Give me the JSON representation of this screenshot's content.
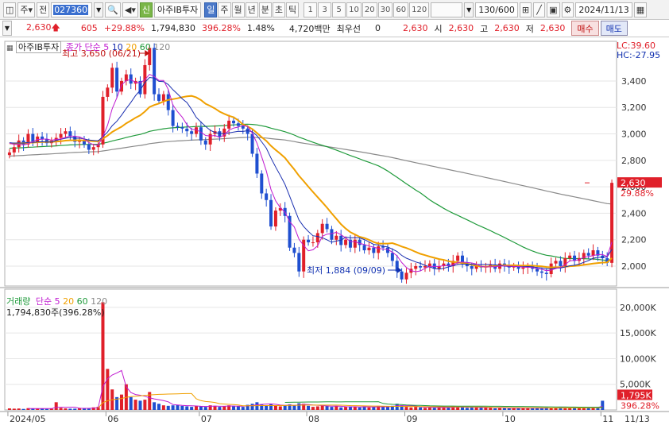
{
  "toolbar": {
    "market_label": "주",
    "type_label": "전",
    "code": "027360",
    "badge_new": "신",
    "stock_name": "아주IB투자",
    "periods": [
      "일",
      "주",
      "월",
      "년",
      "분",
      "초",
      "틱"
    ],
    "active_period": "일",
    "intervals": [
      "1",
      "3",
      "5",
      "10",
      "20",
      "30",
      "60",
      "120"
    ],
    "count": "130",
    "count_total": "/600",
    "date": "2024/11/13"
  },
  "info": {
    "price": "2,630",
    "change": "605",
    "change_pct": "+29.88%",
    "volume": "1,794,830",
    "volume_ratio": "396.28%",
    "turnover": "1.48%",
    "amount": "4,720백만",
    "preferred_label": "최우선",
    "preferred_value": "0",
    "current_price": "2,630",
    "open_label": "시",
    "open": "2,630",
    "high_label": "고",
    "high": "2,630",
    "low_label": "저",
    "low": "2,630",
    "buy_label": "매수",
    "sell_label": "매도"
  },
  "price_panel": {
    "title": "아주IB투자",
    "ma_label": "종가 단순",
    "ma_periods": [
      "5",
      "10",
      "20",
      "60",
      "120"
    ],
    "high_note": "최고 3,650 (06/21)",
    "low_note": "최저 1,884 (09/09)",
    "lc_label": "LC:39.60",
    "hc_label": "HC:-27.95",
    "current_price_tag": "2,630",
    "current_pct_tag": "29.88%",
    "y_ticks": [
      "3,400",
      "3,200",
      "3,000",
      "2,800",
      "2,600",
      "2,400",
      "2,200",
      "2,000"
    ]
  },
  "volume_panel": {
    "title": "거래량",
    "ma_label": "단순",
    "ma_periods": [
      "5",
      "20",
      "60",
      "120"
    ],
    "readout": "1,794,830주(396.28%)",
    "y_ticks": [
      "20,000K",
      "15,000K",
      "10,000K",
      "5,000K"
    ],
    "current_tag": "1,795K",
    "pct_tag": "396.28%"
  },
  "x_axis": {
    "labels": [
      "2024/05",
      "06",
      "07",
      "08",
      "09",
      "10",
      "11"
    ],
    "right_label": "11/13"
  },
  "colors": {
    "up": "#e0202a",
    "down": "#1f4fd0",
    "ma5": "#c01ad0",
    "ma10": "#1a2fb0",
    "ma20": "#f0a000",
    "ma60": "#1e9a3a",
    "ma120": "#8a8a8a"
  },
  "chart_data": {
    "type": "candlestick",
    "y_range": [
      1850,
      3700
    ],
    "volume_range_k": [
      0,
      22000
    ],
    "closes": [
      2860,
      2900,
      2950,
      2920,
      3000,
      2940,
      2980,
      2960,
      2930,
      2950,
      2970,
      3000,
      3020,
      2980,
      2940,
      2950,
      2920,
      2880,
      2900,
      2920,
      3280,
      3350,
      3500,
      3320,
      3400,
      3450,
      3380,
      3400,
      3300,
      3520,
      3650,
      3300,
      3250,
      3300,
      3180,
      3060,
      3050,
      3040,
      3020,
      3000,
      3050,
      2950,
      2920,
      3000,
      3020,
      2980,
      3040,
      3100,
      3080,
      3060,
      3040,
      3000,
      2850,
      2700,
      2550,
      2500,
      2300,
      2420,
      2440,
      2380,
      2140,
      2100,
      1960,
      2200,
      2180,
      2180,
      2250,
      2320,
      2280,
      2200,
      2230,
      2160,
      2200,
      2140,
      2200,
      2160,
      2120,
      2140,
      2100,
      2150,
      2140,
      2100,
      2040,
      1960,
      1900,
      1950,
      1980,
      2000,
      1990,
      2000,
      2020,
      1980,
      2000,
      2020,
      2000,
      2040,
      2080,
      2020,
      2000,
      1980,
      2000,
      1990,
      2000,
      2010,
      1980,
      2020,
      2000,
      1990,
      2000,
      1980,
      1990,
      2000,
      1980,
      1960,
      1950,
      1940,
      2020,
      2040,
      2000,
      2060,
      2080,
      2040,
      2060,
      2100,
      2080,
      2120,
      2080,
      2060,
      2025,
      2630
    ],
    "volume_k": [
      300,
      250,
      280,
      200,
      350,
      300,
      250,
      300,
      200,
      250,
      1500,
      400,
      300,
      250,
      250,
      400,
      350,
      300,
      500,
      600,
      21000,
      8000,
      4000,
      2500,
      3000,
      5000,
      2500,
      2000,
      1800,
      2000,
      3500,
      1500,
      1200,
      900,
      800,
      900,
      1000,
      800,
      700,
      600,
      800,
      700,
      600,
      900,
      800,
      600,
      700,
      900,
      800,
      700,
      600,
      1000,
      1200,
      1500,
      1100,
      900,
      1200,
      800,
      700,
      900,
      1100,
      900,
      1300,
      1200,
      800,
      600,
      700,
      1000,
      800,
      600,
      700,
      500,
      600,
      700,
      600,
      500,
      700,
      500,
      600,
      800,
      600,
      600,
      800,
      1200,
      900,
      600,
      500,
      600,
      500,
      400,
      500,
      400,
      500,
      500,
      400,
      700,
      600,
      500,
      400,
      500,
      500,
      400,
      500,
      400,
      300,
      400,
      400,
      300,
      400,
      300,
      400,
      300,
      300,
      400,
      300,
      500,
      400,
      400,
      500,
      300,
      400,
      500,
      600,
      500,
      500,
      400,
      450,
      1795
    ]
  }
}
